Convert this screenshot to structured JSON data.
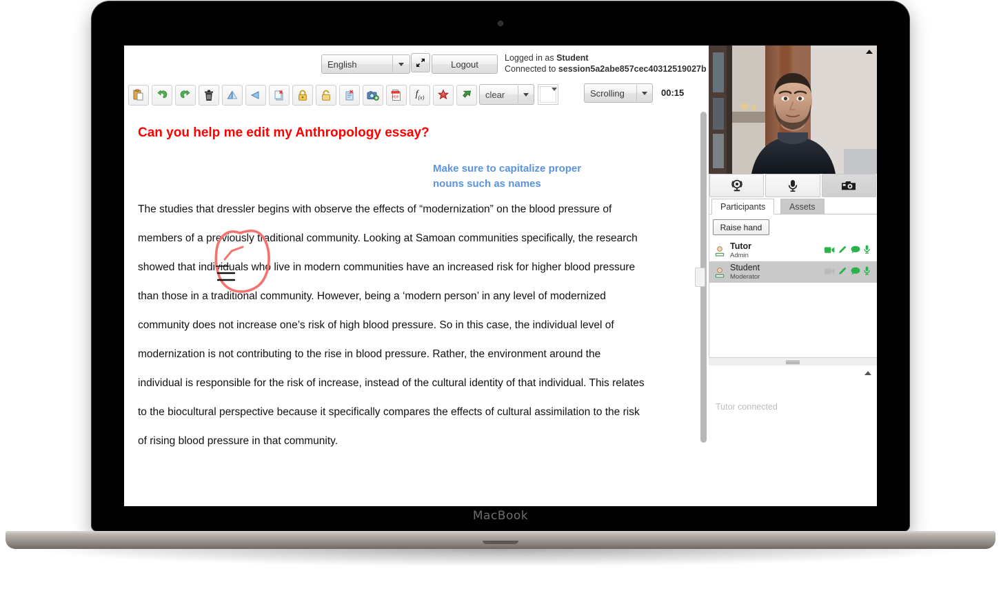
{
  "device": {
    "brand_label": "MacBook"
  },
  "header": {
    "language_select": {
      "value": "English",
      "caret_icon": "chevron-down-icon"
    },
    "fullscreen_icon": "expand-arrows-icon",
    "logout_label": "Logout",
    "logged_in_prefix": "Logged in as ",
    "logged_in_user": "Student",
    "connected_prefix": "Connected to ",
    "session_id": "session5a2abe857cec40312519027b"
  },
  "toolbar": {
    "buttons": [
      {
        "name": "paste-button",
        "icon": "clipboard-paste-icon"
      },
      {
        "name": "undo-button",
        "icon": "undo-arrow-icon"
      },
      {
        "name": "redo-button",
        "icon": "redo-arrow-icon"
      },
      {
        "name": "delete-button",
        "icon": "trash-icon"
      },
      {
        "name": "flip-horizontal-button",
        "icon": "flip-horizontal-icon"
      },
      {
        "name": "flip-vertical-button",
        "icon": "flip-vertical-icon"
      },
      {
        "name": "delete-page-button",
        "icon": "page-delete-icon"
      },
      {
        "name": "lock-button",
        "icon": "lock-closed-icon"
      },
      {
        "name": "unlock-button",
        "icon": "lock-open-icon"
      },
      {
        "name": "clear-page-button",
        "icon": "page-clear-icon"
      },
      {
        "name": "snapshot-button",
        "icon": "camera-add-icon"
      },
      {
        "name": "export-pdf-button",
        "icon": "pdf-icon"
      },
      {
        "name": "formula-button",
        "icon": "function-fx-icon"
      },
      {
        "name": "math-tool-button",
        "icon": "red-star-icon"
      },
      {
        "name": "pointer-button",
        "icon": "green-arrow-icon"
      }
    ],
    "clear_select": {
      "value": "clear",
      "caret_icon": "chevron-down-icon"
    },
    "color_swatch": {
      "name": "color-swatch",
      "value": "#ffffff",
      "caret_icon": "chevron-down-icon"
    },
    "scroll_select": {
      "value": "Scrolling",
      "caret_icon": "chevron-down-icon"
    },
    "timer": "00:15"
  },
  "tool_palette": [
    {
      "name": "tool-select",
      "icon": "cursor-arrow-icon",
      "active": true
    },
    {
      "name": "tool-pencil",
      "icon": "pencil-icon",
      "active": false
    },
    {
      "name": "tool-pen",
      "icon": "pen-icon",
      "active": false
    },
    {
      "name": "tool-eraser",
      "icon": "eraser-icon",
      "active": false
    },
    {
      "name": "tool-text",
      "icon": "text-a-icon",
      "active": false
    },
    {
      "name": "tool-line",
      "icon": "line-icon",
      "active": false
    },
    {
      "name": "tool-rectangle",
      "icon": "rectangle-icon",
      "active": false
    },
    {
      "name": "tool-circle",
      "icon": "circle-icon",
      "active": false
    },
    {
      "name": "tool-triangle",
      "icon": "triangle-icon",
      "active": false
    },
    {
      "name": "tool-polygon",
      "icon": "polygon-icon",
      "active": false
    },
    {
      "name": "tool-highlighter",
      "icon": "highlighter-icon",
      "active": false
    },
    {
      "name": "tool-stamp",
      "icon": "stamp-icon",
      "active": false
    },
    {
      "name": "tool-pan",
      "icon": "hand-icon",
      "active": false
    }
  ],
  "whiteboard": {
    "title": "Can you help me edit my Anthropology essay?",
    "title_color": "#ff0000",
    "annotation_note": "Make sure to capitalize proper nouns such as names",
    "annotation_note_color": "#5b93e0",
    "ink_color": "#f5736f",
    "circled_word": "dressler",
    "body_text": "The studies that dressler begins with observe the effects of “modernization” on the blood pressure of members of a previously traditional community. Looking at Samoan communities specifically, the research showed that individuals who live in modern communities have an increased risk for higher blood pressure than those in a traditional community. However, being a ‘modern person’ in any level of modernized community does not increase one’s risk of high blood pressure. So in this case, the individual level of modernization is not contributing to the rise in blood pressure. Rather, the environment around the individual is responsible for the risk of increase, instead of the cultural identity of that individual. This relates to the biocultural perspective because it specifically compares the effects of cultural assimilation to the risk of rising blood pressure in that community."
  },
  "right_panel": {
    "video": {
      "collapse_icon": "chevron-up-icon"
    },
    "media_buttons": [
      {
        "name": "webcam-toggle-button",
        "icon": "webcam-icon",
        "pressed": false
      },
      {
        "name": "microphone-toggle-button",
        "icon": "microphone-icon",
        "pressed": false
      },
      {
        "name": "snapshot-camera-button",
        "icon": "camera-icon",
        "pressed": true
      }
    ],
    "tabs": [
      {
        "name": "tab-participants",
        "label": "Participants",
        "active": true
      },
      {
        "name": "tab-assets",
        "label": "Assets",
        "active": false
      }
    ],
    "raise_hand_label": "Raise hand",
    "participants": [
      {
        "name": "Tutor",
        "role": "Admin",
        "bold": true,
        "selected": false,
        "icons": [
          {
            "name": "video-icon",
            "enabled": true
          },
          {
            "name": "pencil-icon",
            "enabled": true
          },
          {
            "name": "chat-bubble-icon",
            "enabled": true
          },
          {
            "name": "microphone-icon",
            "enabled": true
          }
        ]
      },
      {
        "name": "Student",
        "role": "Moderator",
        "bold": false,
        "selected": true,
        "icons": [
          {
            "name": "video-icon",
            "enabled": false
          },
          {
            "name": "pencil-icon",
            "enabled": true
          },
          {
            "name": "chat-bubble-icon",
            "enabled": true
          },
          {
            "name": "microphone-icon",
            "enabled": true
          }
        ]
      }
    ],
    "chat": {
      "collapse_icon": "chevron-up-icon",
      "message": "Tutor connected"
    }
  },
  "colors": {
    "icon_green": "#2bb24c",
    "icon_disabled": "#b9b9b9",
    "selection_gray": "#c9c9c9"
  }
}
